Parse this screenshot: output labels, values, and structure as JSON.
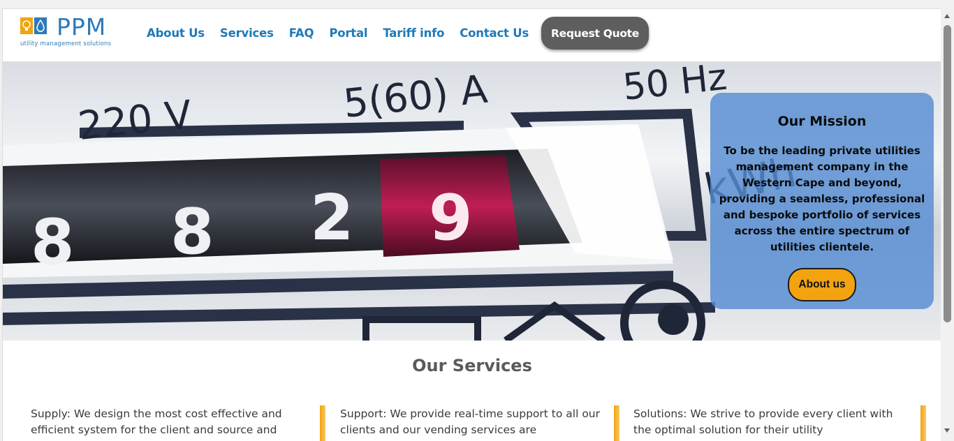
{
  "brand": {
    "name": "PPM",
    "tagline": "utility management solutions",
    "colors": {
      "accent": "#1f7ab7",
      "orange": "#f2a30f",
      "gray": "#5e5e5e"
    }
  },
  "nav": {
    "items": [
      {
        "label": "About Us"
      },
      {
        "label": "Services"
      },
      {
        "label": "FAQ"
      },
      {
        "label": "Portal"
      },
      {
        "label": "Tariff info"
      },
      {
        "label": "Contact Us"
      }
    ],
    "cta": "Request Quote"
  },
  "hero": {
    "meter_texts": {
      "voltage": "220 V",
      "current": "5(60) A",
      "freq": "50 Hz",
      "unit": "kWh"
    },
    "digits": [
      "8",
      "8",
      "2",
      "9"
    ],
    "mission": {
      "title": "Our Mission",
      "body": "To be the leading private utilities management company in the Western Cape and beyond, providing a seamless, professional and bespoke portfolio of services across the entire spectrum of utilities clientele.",
      "button": "About us"
    }
  },
  "services": {
    "title": "Our Services",
    "items": [
      {
        "text": "Supply: We design the most cost effective and efficient system for the client and source and"
      },
      {
        "text": "Support: We provide real-time support to all our clients and our vending services are"
      },
      {
        "text": "Solutions: We strive to provide every client with the optimal solution for their utility"
      }
    ]
  }
}
